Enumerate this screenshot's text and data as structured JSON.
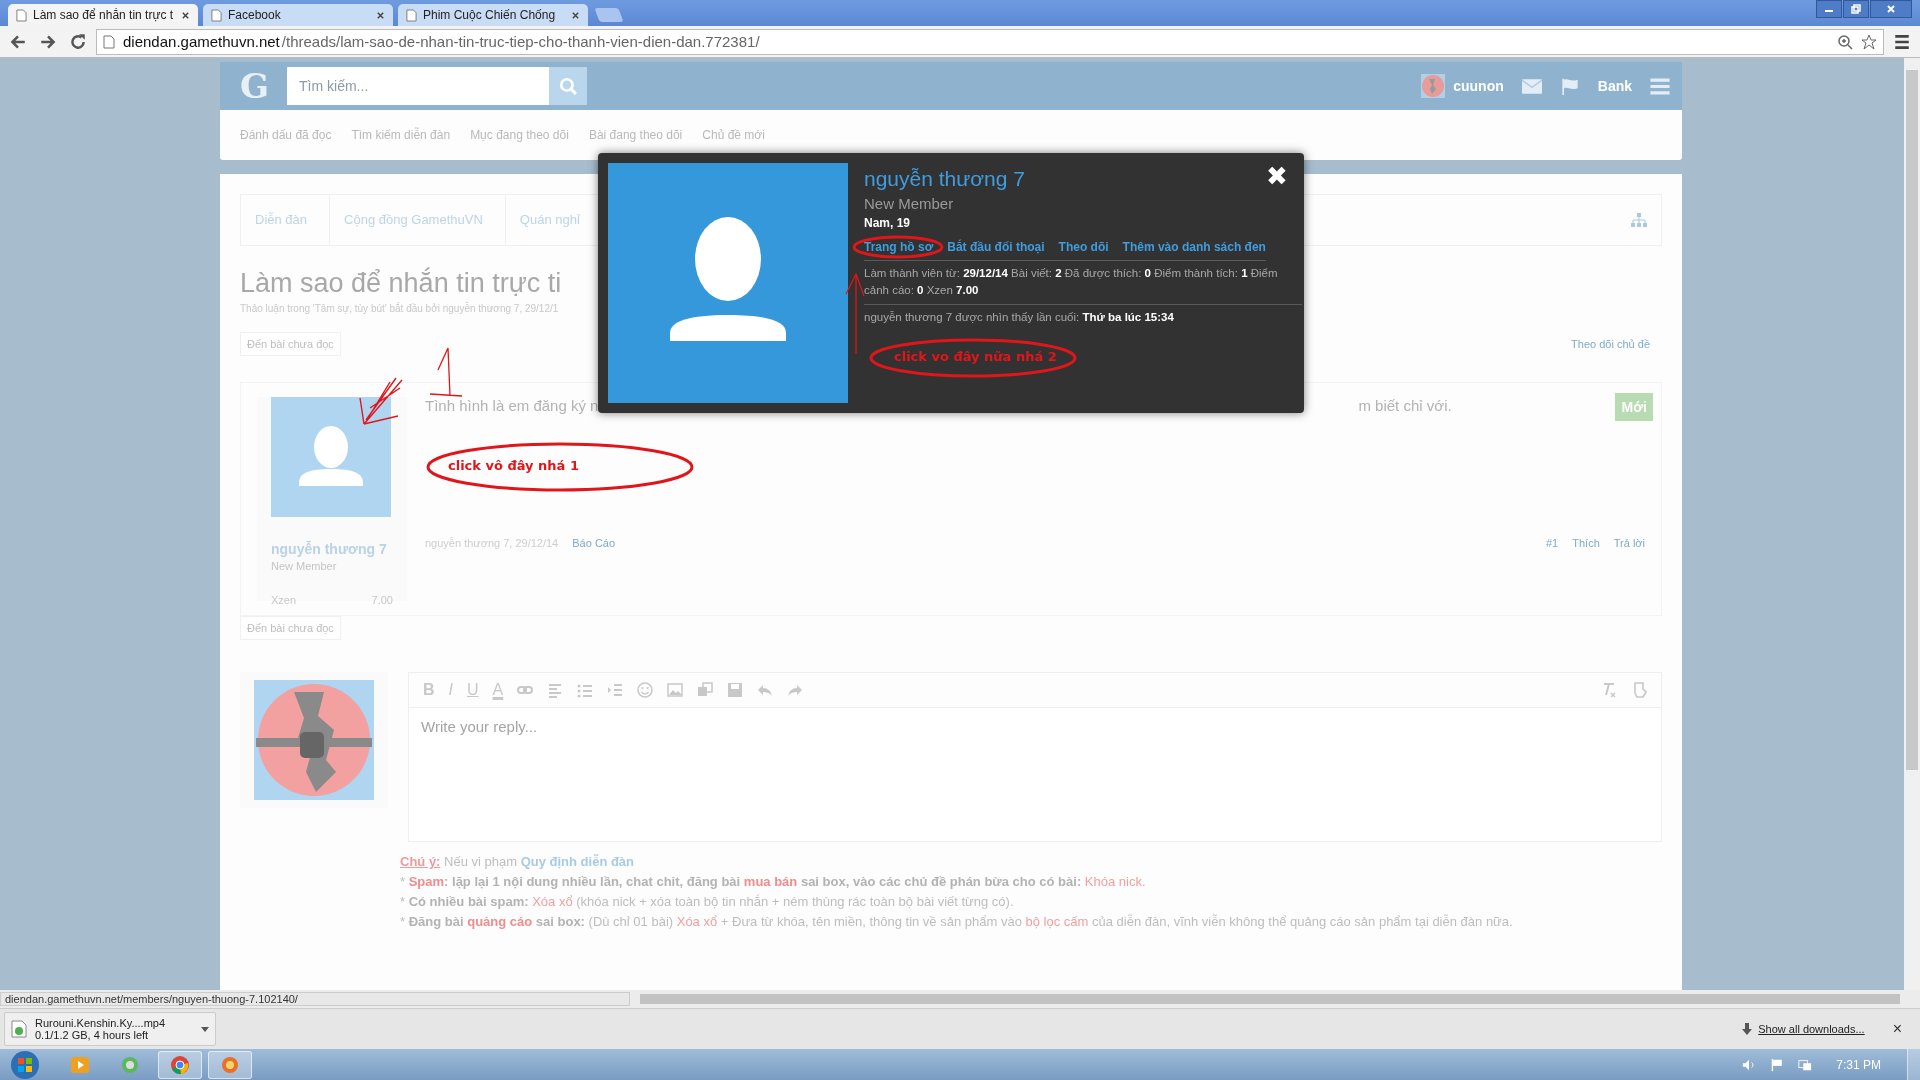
{
  "browser": {
    "tabs": [
      {
        "title": "Làm sao để nhắn tin trực t",
        "selected": true
      },
      {
        "title": "Facebook",
        "selected": false
      },
      {
        "title": "Phim Cuộc Chiến Chống",
        "selected": false
      }
    ],
    "url_host": "diendan.gamethuvn.net",
    "url_path": "/threads/lam-sao-de-nhan-tin-truc-tiep-cho-thanh-vien-dien-dan.772381/"
  },
  "header": {
    "logo": "G",
    "search": {
      "placeholder": "Tìm kiếm..."
    },
    "username": "cuunon",
    "bank": "Bank"
  },
  "nav": [
    "Đánh dấu đã đọc",
    "Tìm kiếm diễn đàn",
    "Mục đang theo dõi",
    "Bài đang theo dõi",
    "Chủ đề mới"
  ],
  "breadcrumb": [
    "Diễn đàn",
    "Cộng đồng GamethuVN",
    "Quán nghỉ"
  ],
  "thread": {
    "title": "Làm sao để nhắn tin trực ti",
    "subtitle": "Thảo luận trong 'Tâm sự, tùy bút' bắt đầu bởi nguyễn thương 7, 29/12/1",
    "unread_button": "Đến bài chưa đọc",
    "watch": "Theo dõi chủ đề"
  },
  "post": {
    "author": "nguyễn thương 7",
    "role": "New Member",
    "xzen_label": "Xzen",
    "xzen_value": "7.00",
    "text_start": "Tình hình là em đăng ký n",
    "text_end": "m biết chỉ với.",
    "new_badge": "Mới",
    "meta_author": "nguyễn thương 7, 29/12/14",
    "report": "Báo Cáo",
    "number": "#1",
    "like": "Thích",
    "reply": "Trả lời"
  },
  "unread_button_2": "Đến bài chưa đọc",
  "editor": {
    "format_buttons": [
      "B",
      "I",
      "U",
      "A"
    ],
    "placeholder": "Write your reply..."
  },
  "rules": [
    [
      {
        "kind": "note",
        "text": "Chú ý:"
      },
      {
        "kind": "plain",
        "text": " Nếu vi phạm "
      },
      {
        "kind": "link",
        "text": "Quy định diễn đàn"
      }
    ],
    [
      {
        "kind": "plain",
        "text": "* "
      },
      {
        "kind": "redbold",
        "text": "Spam"
      },
      {
        "kind": "bold",
        "text": ": lặp lại 1 nội dung nhiều lần, chat chit, đăng bài "
      },
      {
        "kind": "redbold",
        "text": "mua bán"
      },
      {
        "kind": "bold",
        "text": " sai box, vào các chủ đề phán bừa cho có bài:"
      },
      {
        "kind": "red",
        "text": " Khóa nick."
      }
    ],
    [
      {
        "kind": "plain",
        "text": "* "
      },
      {
        "kind": "bold",
        "text": "Có nhiều bài spam:"
      },
      {
        "kind": "red",
        "text": " Xóa xổ"
      },
      {
        "kind": "plain",
        "text": " (khóa nick + xóa toàn bộ tin nhắn + ném thùng rác toàn bộ bài viết từng có)."
      }
    ],
    [
      {
        "kind": "plain",
        "text": "* "
      },
      {
        "kind": "bold",
        "text": "Đăng bài "
      },
      {
        "kind": "redbold",
        "text": "quảng cáo"
      },
      {
        "kind": "bold",
        "text": " sai box:"
      },
      {
        "kind": "plain",
        "text": " (Dù chỉ 01 bài) "
      },
      {
        "kind": "red",
        "text": "Xóa xổ"
      },
      {
        "kind": "plain",
        "text": " + Đưa từ khóa, tên miền, thông tin về sản phẩm vào "
      },
      {
        "kind": "red",
        "text": "bộ lọc cấm"
      },
      {
        "kind": "plain",
        "text": " của diễn đàn, vĩnh viễn không thể quảng cáo sản phẩm tại diễn đàn nữa."
      }
    ]
  ],
  "popup": {
    "name": "nguyễn thương 7",
    "role": "New Member",
    "info": "Nam, 19",
    "actions": [
      "Trang hồ sơ",
      "Bắt đầu đối thoại",
      "Theo dõi",
      "Thêm vào danh sách đen"
    ],
    "stats": "Làm thành viên từ: **29/12/14**  Bài viết: **2**  Đã được thích: **0**  Điểm thành tích: **1**  Điểm cảnh cáo: **0**  Xzen **7.00**",
    "last_seen": "nguyễn thương 7 được nhìn thấy lần cuối: **Thứ ba lúc 15:34**",
    "close": "✖"
  },
  "annotations": [
    {
      "text": "click vô đây nhá 1"
    },
    {
      "text": "click vo đây nữa nhá 2"
    }
  ],
  "status_url": "diendan.gamethuvn.net/members/nguyen-thuong-7.102140/",
  "download": {
    "file": "Rurouni.Kenshin.Ky....mp4",
    "progress": "0.1/1.2 GB, 4 hours left",
    "show_all": "Show all downloads...",
    "close": "×"
  },
  "taskbar": {
    "time": "7:31 PM"
  }
}
